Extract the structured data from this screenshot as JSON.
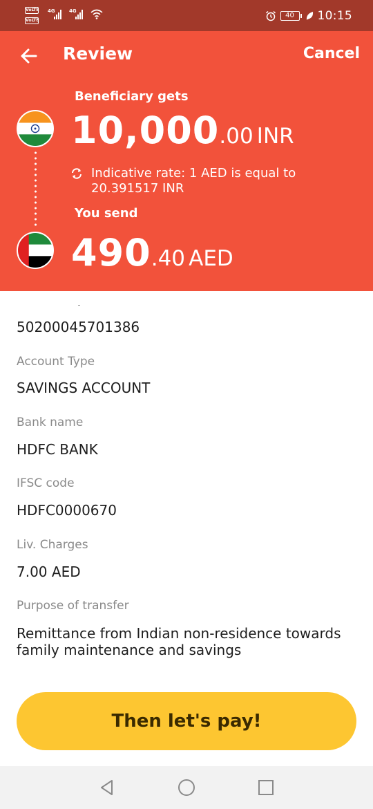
{
  "status_bar": {
    "volte_1": "VoLTE",
    "volte_2": "VoLTE",
    "net_1": "4G",
    "net_2": "4G",
    "battery": "40",
    "time": "10:15",
    "icons": [
      "volte-icon",
      "signal-icon",
      "wifi-icon",
      "alarm-icon",
      "battery-icon",
      "leaf-icon"
    ]
  },
  "header": {
    "title": "Review",
    "cancel_label": "Cancel",
    "beneficiary_label": "Beneficiary gets",
    "gets_amount_whole": "10,000",
    "gets_amount_fraction": ".00",
    "gets_currency": "INR",
    "rate_text": "Indicative rate: 1 AED is equal to 20.391517 INR",
    "send_label": "You send",
    "send_amount_whole": "490",
    "send_amount_fraction": ".40",
    "send_currency": "AED",
    "background_color": "#f2523b"
  },
  "details": {
    "account_number": "50200045701386",
    "account_type_label": "Account Type",
    "account_type": "SAVINGS ACCOUNT",
    "bank_name_label": "Bank name",
    "bank_name": "HDFC BANK",
    "ifsc_label": "IFSC code",
    "ifsc": "HDFC0000670",
    "charges_label": "Liv. Charges",
    "charges": "7.00 AED",
    "purpose_label": "Purpose of transfer",
    "purpose": "Remittance from Indian non-residence towards family maintenance and savings"
  },
  "pay_button": {
    "label": "Then let's pay!",
    "color": "#fdc631"
  },
  "nav": {
    "icons": [
      "back-triangle-icon",
      "home-circle-icon",
      "recents-square-icon"
    ]
  }
}
